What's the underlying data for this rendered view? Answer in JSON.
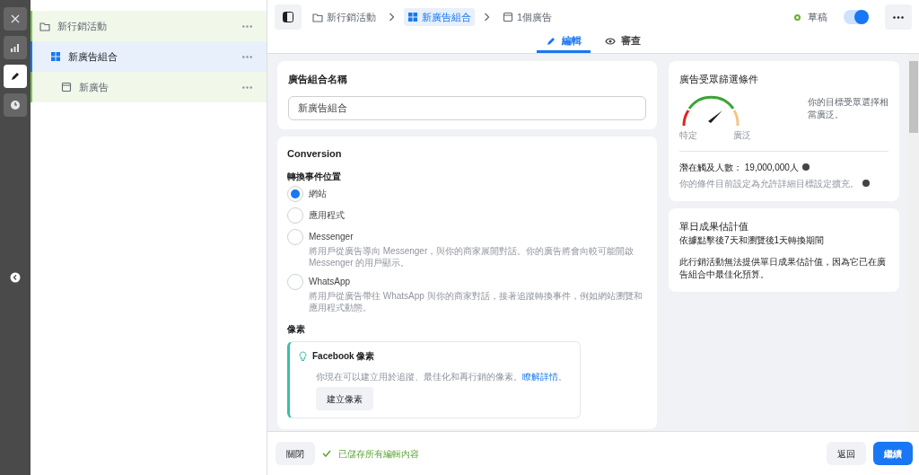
{
  "rail": [
    {
      "kind": "close",
      "selected": false
    },
    {
      "kind": "chart",
      "selected": false
    },
    {
      "kind": "edit",
      "selected": true
    },
    {
      "kind": "history",
      "selected": false
    },
    {
      "kind": "collapse",
      "selected": false
    }
  ],
  "tree": [
    {
      "kind": "campaign",
      "label": "新行銷活動",
      "selected": false,
      "children": [
        {
          "kind": "adset",
          "label": "新廣告組合",
          "selected": true,
          "children": [
            {
              "kind": "ad",
              "label": "新廣告",
              "selected": false
            }
          ]
        }
      ]
    }
  ],
  "breadcrumbs": [
    {
      "kind": "campaign",
      "label": "新行銷活動",
      "selected": false
    },
    {
      "kind": "adset",
      "label": "新廣告組合",
      "selected": true
    },
    {
      "kind": "ad",
      "label": "1個廣告",
      "selected": false
    }
  ],
  "status": {
    "label": "草稿",
    "on": true
  },
  "tabs": [
    {
      "kind": "edit",
      "label": "編輯",
      "selected": true
    },
    {
      "kind": "review",
      "label": "審查",
      "selected": false
    }
  ],
  "name_card": {
    "title": "廣告組合名稱",
    "value": "新廣告組合"
  },
  "conversion": {
    "title": "Conversion",
    "label": "轉換事件位置",
    "options": [
      {
        "label": "網站",
        "selected": true
      },
      {
        "label": "應用程式",
        "selected": false
      },
      {
        "label": "Messenger",
        "description": "將用戶從廣告導向 Messenger，與你的商家展開對話。你的廣告將會向較可能開啟 Messenger 的用戶顯示。",
        "selected": false
      },
      {
        "label": "WhatsApp",
        "description": "將用戶從廣告帶往 WhatsApp 與你的商家對話，接著追蹤轉換事件，例如網站瀏覽和應用程式動態。",
        "selected": false
      }
    ],
    "pixel_label": "像素",
    "pixel": {
      "title": "Facebook 像素",
      "text": "你現在可以建立用於追蹤、最佳化和再行銷的像素。",
      "link": "瞭解詳情",
      "after": "。",
      "button": "建立像素"
    }
  },
  "audience": {
    "title": "廣告受眾篩選條件",
    "narrow": "特定",
    "broad": "廣泛",
    "summary": "你的目標受眾選擇相當廣泛。",
    "reach": "潛在觸及人數： 19,000,000人",
    "note": "你的條件目前設定為允許詳細目標設定擴充。"
  },
  "estimate": {
    "title": "單日成果估計值",
    "subtitle": "依據點擊後7天和瀏覽後1天轉換期間",
    "text": "此行銷活動無法提供單日成果估計值，因為它已在廣告組合中最佳化預算。"
  },
  "footer": {
    "close": "關閉",
    "saved": "已儲存所有編輯內容",
    "back": "返回",
    "continue": "繼續"
  }
}
